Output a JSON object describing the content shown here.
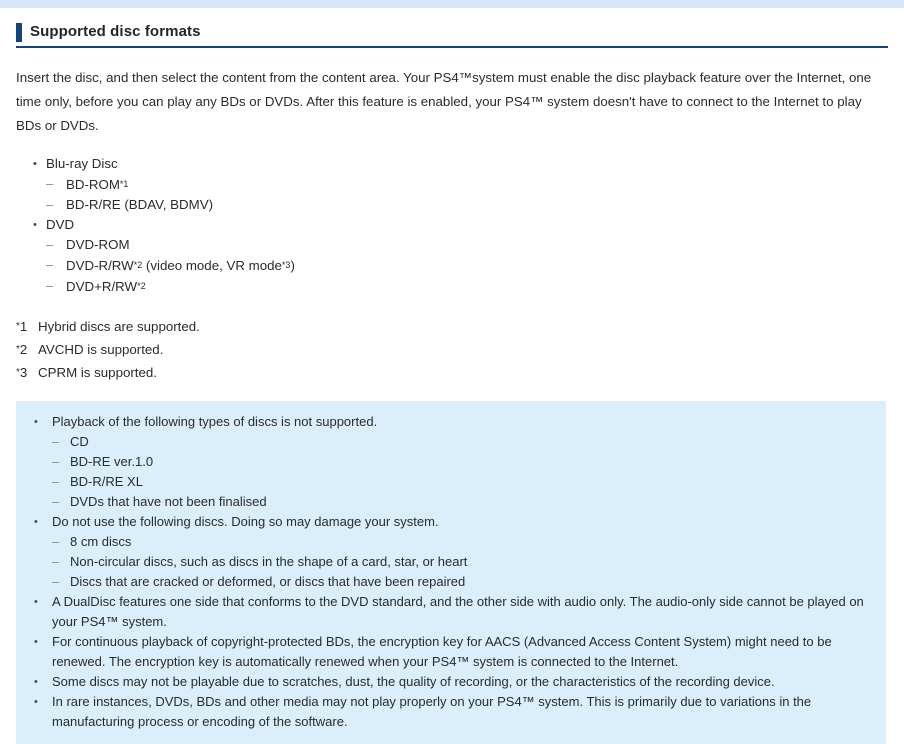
{
  "colors": {
    "top_strip": "#d6e6fb",
    "accent_navy": "#12447c",
    "note_box_bg": "#dbeefb",
    "body_text": "#2b2b2b",
    "dash_marker": "#8a8f95"
  },
  "header": {
    "title": "Supported disc formats"
  },
  "intro": {
    "paragraph": "Insert the disc, and then select the content from the content area. Your PS4™system must enable the disc playback feature over the Internet, one time only, before you can play any BDs or DVDs. After this feature is enabled, your PS4™ system doesn't have to connect to the Internet to play BDs or DVDs."
  },
  "formats": [
    {
      "label": "Blu-ray Disc",
      "bullet": "•",
      "children": [
        {
          "dash": "–",
          "text": "BD-ROM",
          "footnote": "*1"
        },
        {
          "dash": "–",
          "text": "BD-R/RE (BDAV, BDMV)",
          "footnote": ""
        }
      ]
    },
    {
      "label": "DVD",
      "bullet": "•",
      "children": [
        {
          "dash": "–",
          "text": "DVD-ROM",
          "footnote": ""
        },
        {
          "dash": "–",
          "text": "DVD-R/RW",
          "footnote": "*2",
          "text_after": " (video mode, VR mode",
          "footnote2": "*3",
          "text_end": ")"
        },
        {
          "dash": "–",
          "text": "DVD+R/RW",
          "footnote": "*2"
        }
      ]
    }
  ],
  "footnotes": [
    {
      "star": "*",
      "number": "1",
      "text": "Hybrid discs are supported."
    },
    {
      "star": "*",
      "number": "2",
      "text": "AVCHD is supported."
    },
    {
      "star": "*",
      "number": "3",
      "text": "CPRM is supported."
    }
  ],
  "note_box": {
    "bullet": "•",
    "dash": "–",
    "items": [
      {
        "text": "Playback of the following types of discs is not supported.",
        "children": [
          "CD",
          "BD-RE ver.1.0",
          "BD-R/RE XL",
          "DVDs that have not been finalised"
        ]
      },
      {
        "text": "Do not use the following discs. Doing so may damage your system.",
        "children": [
          "8 cm discs",
          "Non-circular discs, such as discs in the shape of a card, star, or heart",
          "Discs that are cracked or deformed, or discs that have been repaired"
        ]
      },
      {
        "text": "A DualDisc features one side that conforms to the DVD standard, and the other side with audio only. The audio-only side cannot be played on your PS4™ system.",
        "children": []
      },
      {
        "text": "For continuous playback of copyright-protected BDs, the encryption key for AACS (Advanced Access Content System) might need to be renewed. The encryption key is automatically renewed when your PS4™ system is connected to the Internet.",
        "children": []
      },
      {
        "text": "Some discs may not be playable due to scratches, dust, the quality of recording, or the characteristics of the recording device.",
        "children": []
      },
      {
        "text": "In rare instances, DVDs, BDs and other media may not play properly on your PS4™ system. This is primarily due to variations in the manufacturing process or encoding of the software.",
        "children": []
      }
    ]
  }
}
